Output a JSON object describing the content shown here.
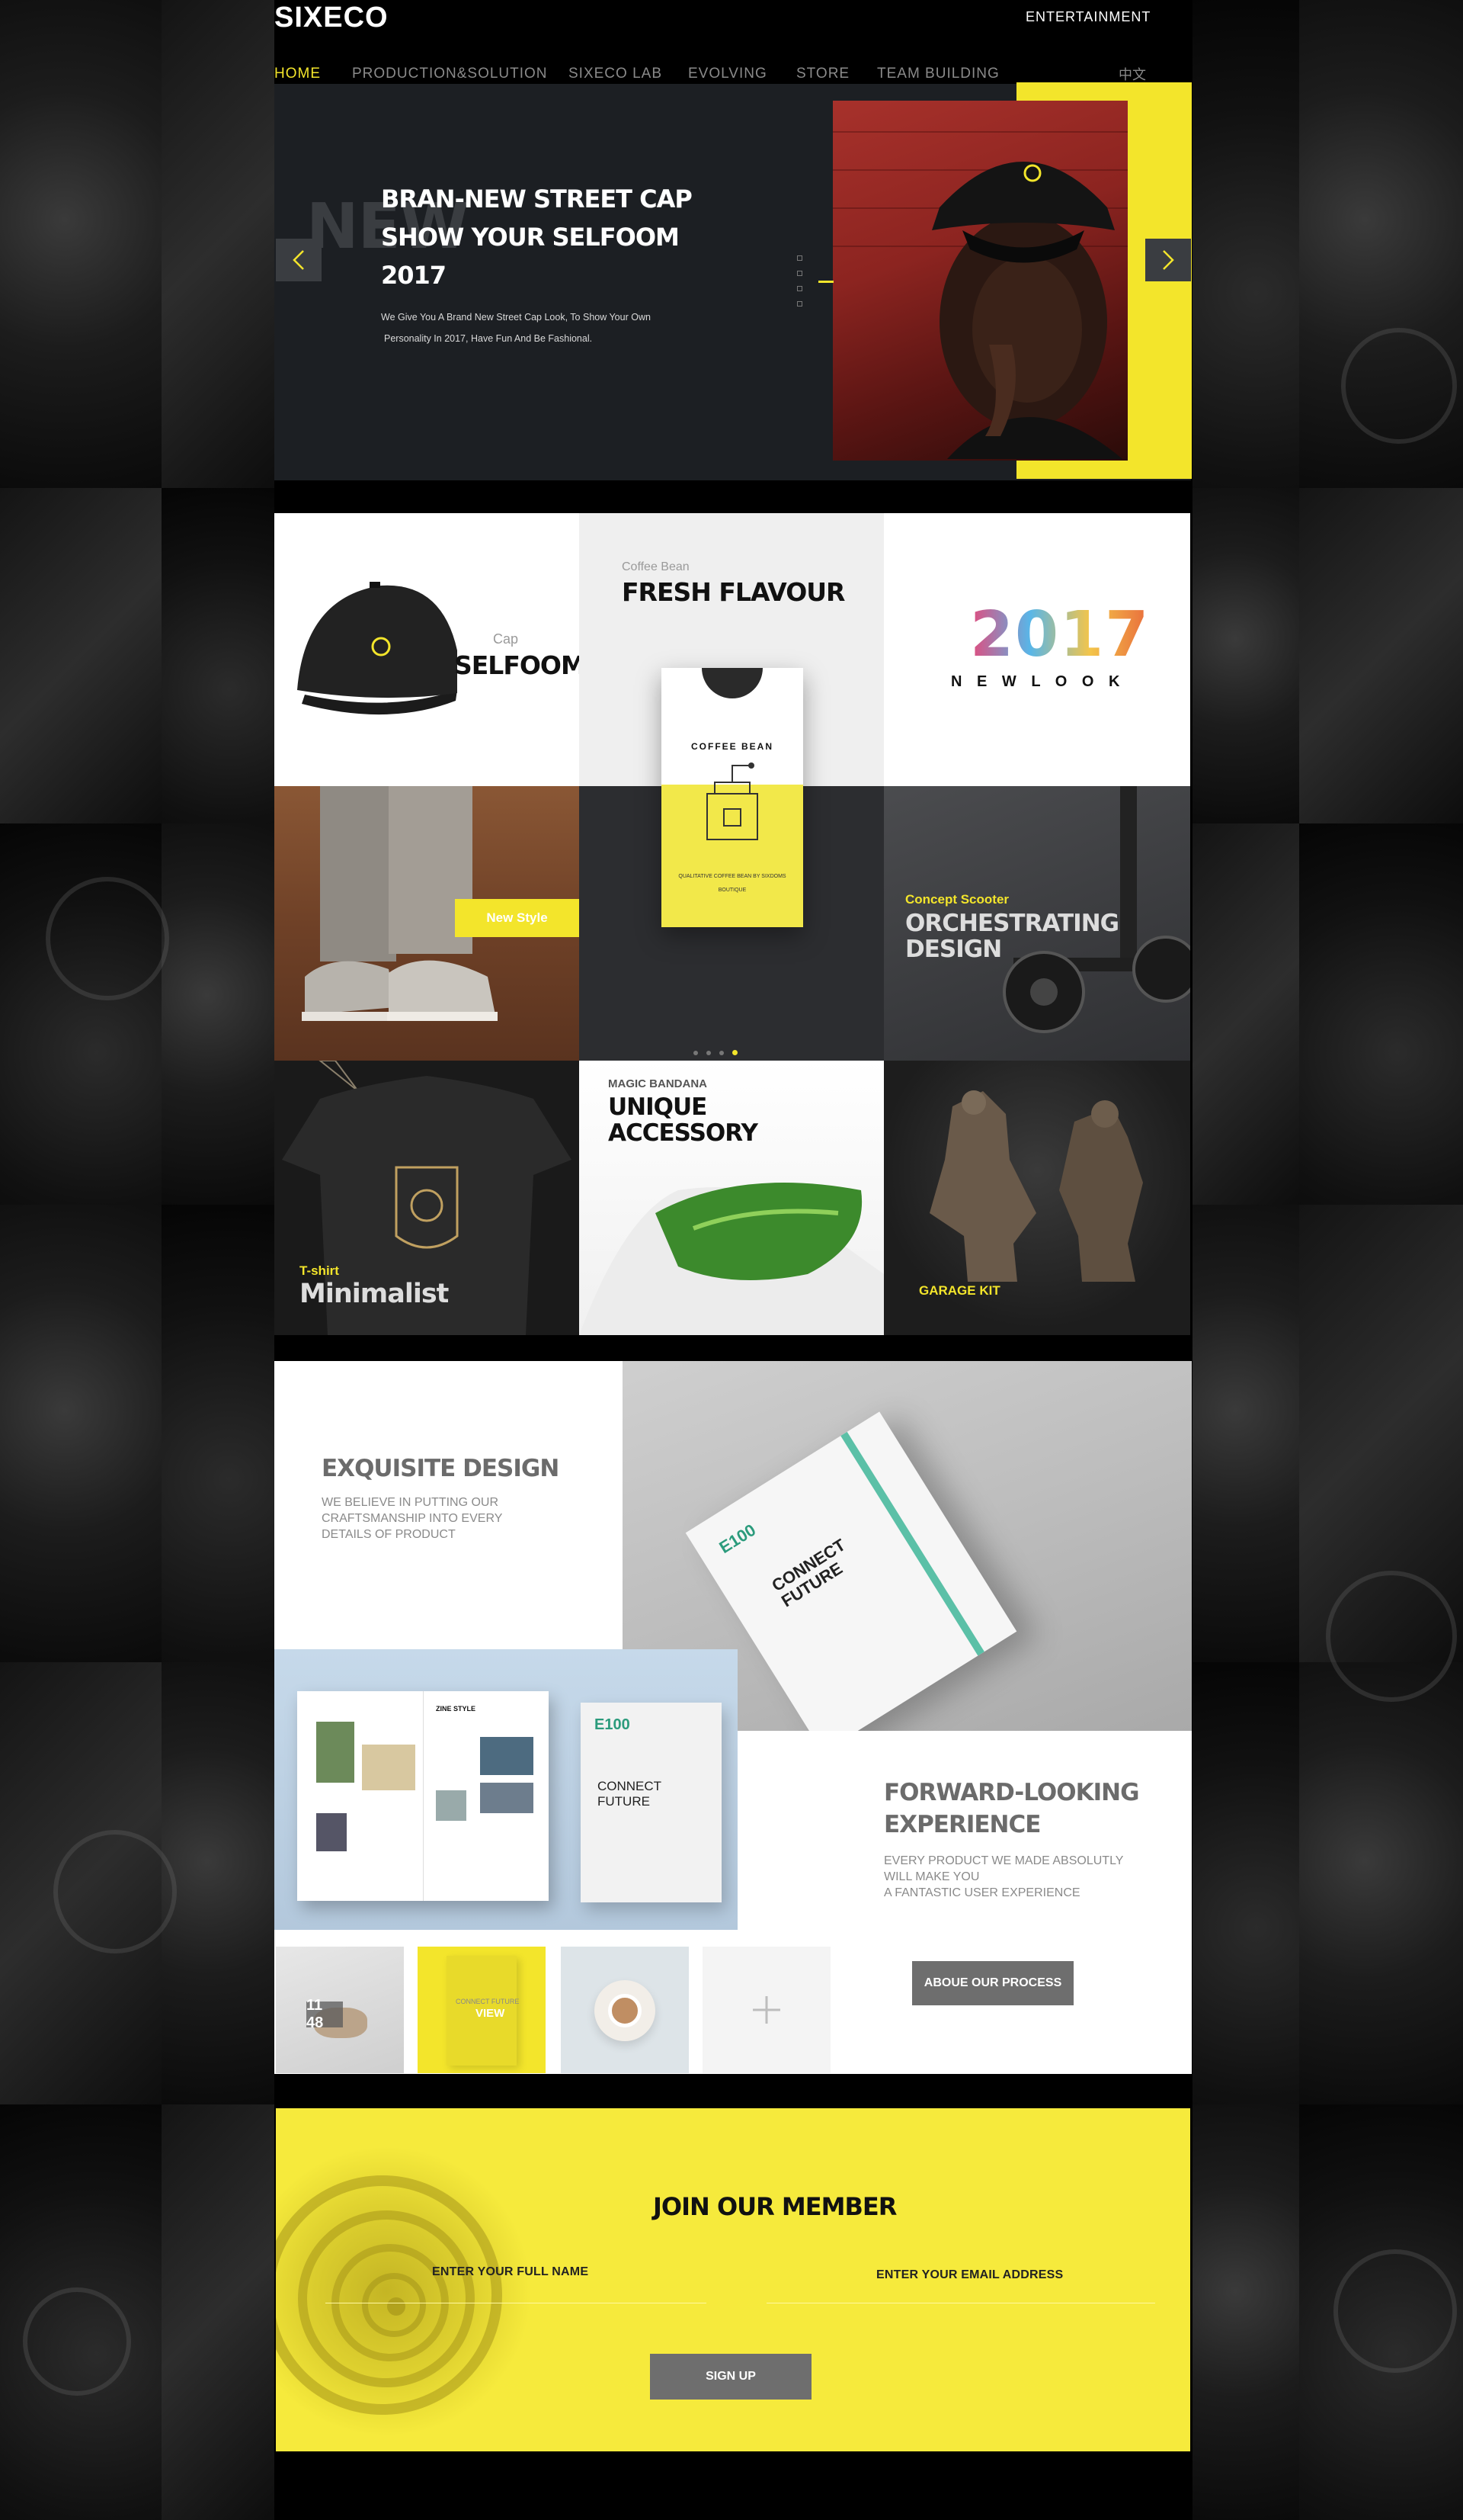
{
  "header": {
    "logo": "SIXECO",
    "top_link": "ENTERTAINMENT",
    "nav": [
      "HOME",
      "PRODUCTION&SOLUTION",
      "SIXECO LAB",
      "EVOLVING",
      "STORE",
      "TEAM BUILDING"
    ],
    "lang": "中文"
  },
  "hero": {
    "ghost": "NEW",
    "title_line1": "BRAN-NEW STREET CAP",
    "title_line2": "SHOW YOUR SELFOOM",
    "title_line3": "2017",
    "text_line1": "We Give You A Brand New Street Cap Look,   To Show Your Own",
    "text_line2": "Personality In 2017,   Have Fun And Be Fashional."
  },
  "grid": {
    "cap_sub": "Cap",
    "cap_title": "SELFOOM",
    "coffee_sub": "Coffee Bean",
    "coffee_title": "FRESH FLAVOUR",
    "bag_label": "COFFEE BEAN",
    "bag_small1": "QUALITATIVE COFFEE BEAN BY SIXDOMS",
    "bag_small2": "BOUTIQUE",
    "year": "2017",
    "newlook": "N E W L O O K",
    "new_style": "New Style",
    "scooter_sub": "Concept Scooter",
    "scooter_t1": "ORCHESTRATING",
    "scooter_t2": "DESIGN",
    "tshirt_sub": "T-shirt",
    "tshirt_title": "Minimalist",
    "bandana_sub": "MAGIC BANDANA",
    "bandana_t1": "UNIQUE",
    "bandana_t2": "ACCESSORY",
    "garage": "GARAGE KIT"
  },
  "design": {
    "head1": "EXQUISITE DESIGN",
    "p1_l1": "WE BELIEVE IN PUTTING OUR",
    "p1_l2": "CRAFTSMANSHIP INTO EVERY",
    "p1_l3": "DETAILS OF PRODUCT",
    "notebook_brand": "E100",
    "notebook_t1": "CONNECT",
    "notebook_t2": "FUTURE",
    "mag_zine": "ZINE STYLE",
    "mag_brand": "E100",
    "mag_t1": "CONNECT",
    "mag_t2": "FUTURE",
    "head2_l1": "FORWARD-LOOKING",
    "head2_l2": "EXPERIENCE",
    "p2_l1": "EVERY PRODUCT WE MADE ABSOLUTLY",
    "p2_l2": "WILL MAKE YOU",
    "p2_l3": "A  FANTASTIC USER EXPERIENCE",
    "thumb_time": "11 48",
    "thumb_view": "VIEW",
    "thumb_book": "CONNECT FUTURE",
    "process_btn": "ABOUE OUR PROCESS"
  },
  "join": {
    "title": "JOIN OUR MEMBER",
    "name_label": "ENTER YOUR FULL NAME",
    "email_label": "ENTER YOUR EMAIL ADDRESS",
    "signup": "SIGN UP"
  },
  "colors": {
    "accent": "#f3e52b",
    "dark": "#1c1f23",
    "gray_btn": "#6e6e6e"
  }
}
